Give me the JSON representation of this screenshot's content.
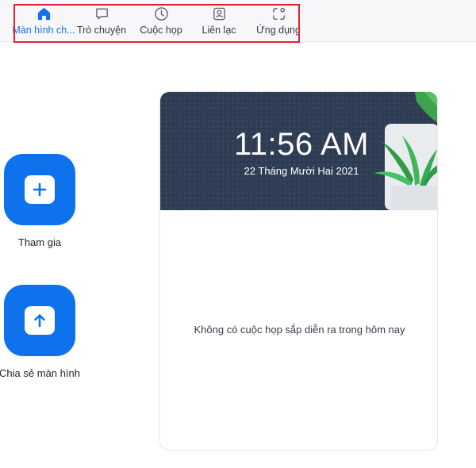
{
  "nav": {
    "tabs": [
      {
        "label": "Màn hình ch...",
        "icon": "home-icon",
        "active": true
      },
      {
        "label": "Trò chuyện",
        "icon": "chat-icon",
        "active": false
      },
      {
        "label": "Cuộc họp",
        "icon": "clock-icon",
        "active": false
      },
      {
        "label": "Liên lạc",
        "icon": "contact-icon",
        "active": false
      },
      {
        "label": "Ứng dụng",
        "icon": "apps-icon",
        "active": false
      }
    ]
  },
  "actions": {
    "join_label": "Tham gia",
    "share_label": "Chia sẻ màn hình"
  },
  "calendar": {
    "time": "11:56 AM",
    "date": "22 Tháng Mười Hai 2021",
    "empty_message": "Không có cuộc họp sắp diễn ra trong hôm nay"
  },
  "colors": {
    "accent": "#0e72ed",
    "highlight": "#e0232e",
    "banner": "#2e3d54"
  }
}
